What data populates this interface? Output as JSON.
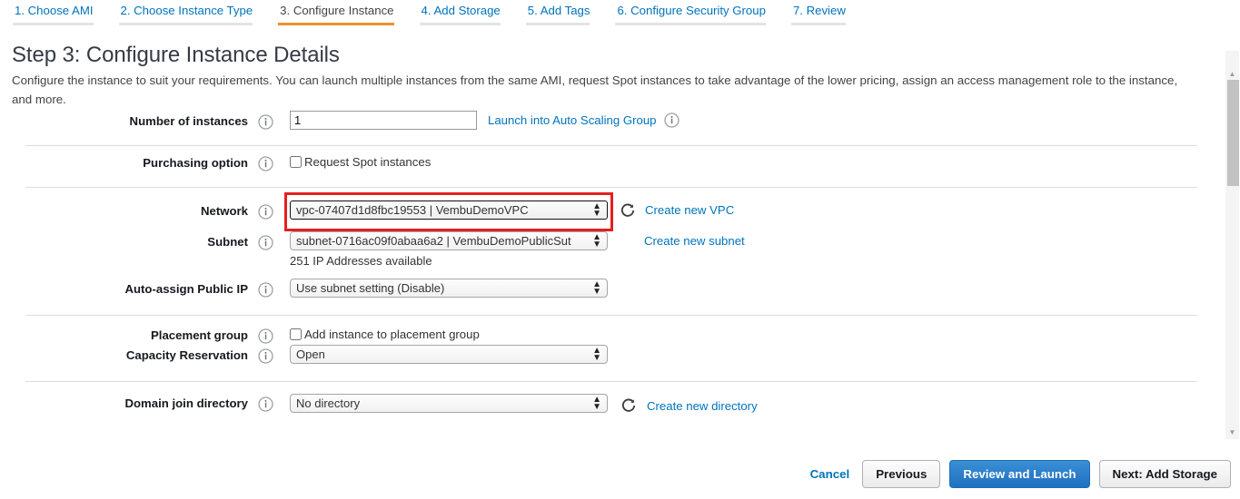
{
  "wizard": {
    "tabs": [
      {
        "label": "1. Choose AMI",
        "active": false
      },
      {
        "label": "2. Choose Instance Type",
        "active": false
      },
      {
        "label": "3. Configure Instance",
        "active": true
      },
      {
        "label": "4. Add Storage",
        "active": false
      },
      {
        "label": "5. Add Tags",
        "active": false
      },
      {
        "label": "6. Configure Security Group",
        "active": false
      },
      {
        "label": "7. Review",
        "active": false
      }
    ],
    "active_color": "#ec912d",
    "link_color": "#0073bb"
  },
  "page": {
    "title": "Step 3: Configure Instance Details",
    "description": "Configure the instance to suit your requirements. You can launch multiple instances from the same AMI, request Spot instances to take advantage of the lower pricing, assign an access management role to the instance, and more."
  },
  "form": {
    "number_of_instances": {
      "label": "Number of instances",
      "value": "1",
      "link": "Launch into Auto Scaling Group"
    },
    "purchasing_option": {
      "label": "Purchasing option",
      "checkbox_label": "Request Spot instances",
      "checked": false
    },
    "network": {
      "label": "Network",
      "value": "vpc-07407d1d8fbc19553 | VembuDemoVPC",
      "link": "Create new VPC",
      "highlight_color": "#e41f1f",
      "highlighted": true
    },
    "subnet": {
      "label": "Subnet",
      "value": "subnet-0716ac09f0abaa6a2 | VembuDemoPublicSut",
      "link": "Create new subnet",
      "note": "251 IP Addresses available"
    },
    "auto_assign_public_ip": {
      "label": "Auto-assign Public IP",
      "value": "Use subnet setting (Disable)"
    },
    "placement_group": {
      "label": "Placement group",
      "checkbox_label": "Add instance to placement group",
      "checked": false
    },
    "capacity_reservation": {
      "label": "Capacity Reservation",
      "value": "Open"
    },
    "domain_join_directory": {
      "label": "Domain join directory",
      "value": "No directory",
      "link": "Create new directory"
    }
  },
  "footer": {
    "cancel": "Cancel",
    "previous": "Previous",
    "review_and_launch": "Review and Launch",
    "next": "Next: Add Storage"
  }
}
